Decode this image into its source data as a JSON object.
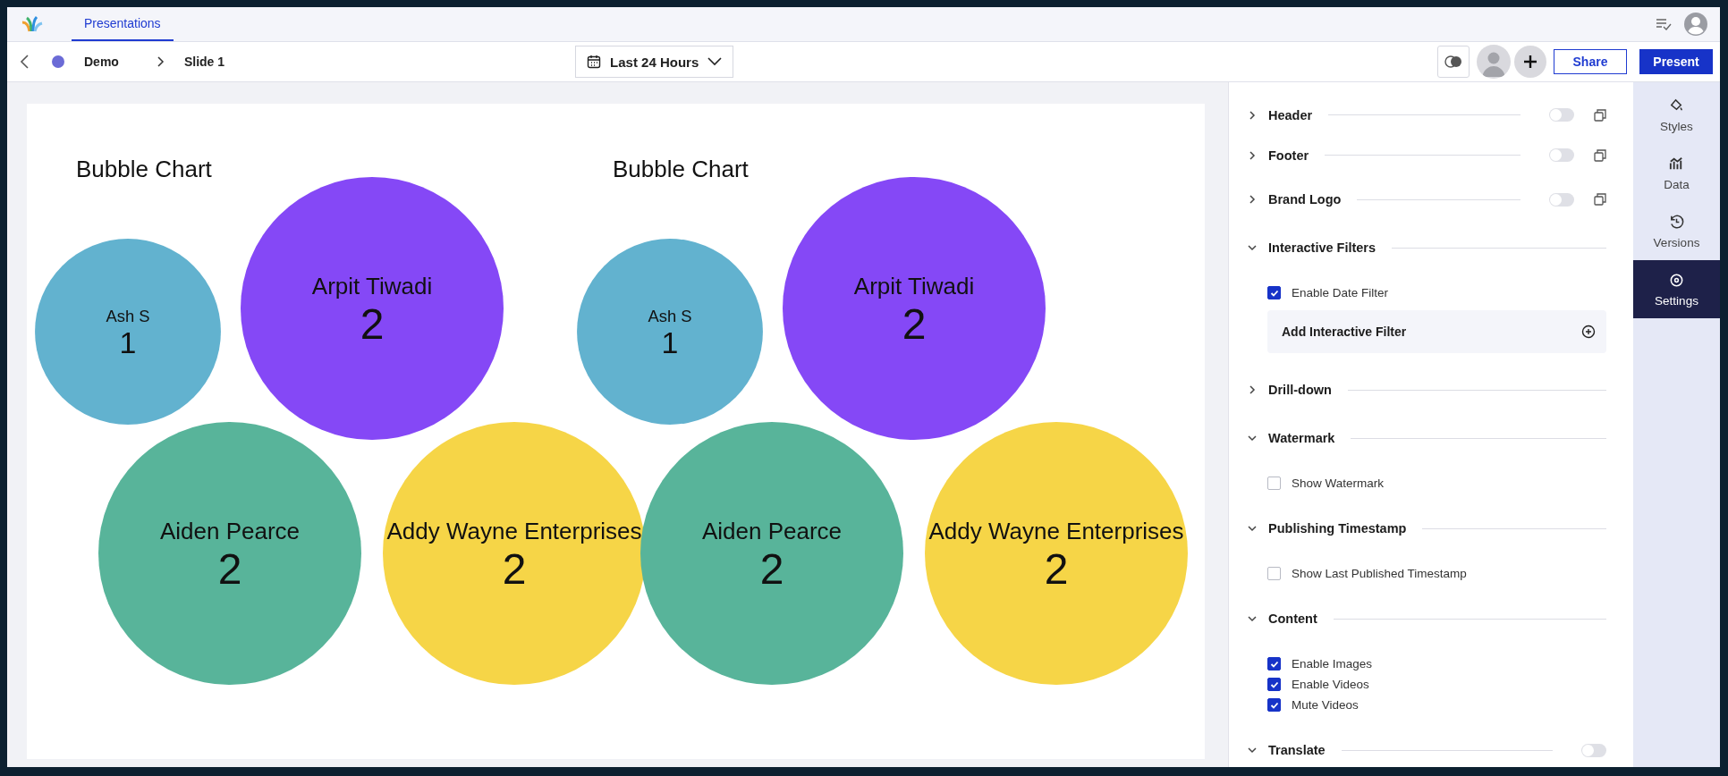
{
  "top_bar": {
    "tabs": [
      {
        "label": "Presentations",
        "selected": true
      }
    ]
  },
  "toolbar": {
    "project": "Demo",
    "page": "Slide 1",
    "date_range": "Last 24 Hours",
    "share": "Share",
    "present": "Present"
  },
  "slide": {
    "charts": [
      {
        "title": "Bubble Chart",
        "bubbles": [
          {
            "name": "Ash S",
            "value": "1",
            "color": "#62b2cf"
          },
          {
            "name": "Arpit Tiwadi",
            "value": "2",
            "color": "#8548f6"
          },
          {
            "name": "Aiden Pearce",
            "value": "2",
            "color": "#58b49a"
          },
          {
            "name": "Addy Wayne Enterprises",
            "value": "2",
            "color": "#f6d547"
          }
        ]
      },
      {
        "title": "Bubble Chart",
        "bubbles": [
          {
            "name": "Ash S",
            "value": "1",
            "color": "#62b2cf"
          },
          {
            "name": "Arpit Tiwadi",
            "value": "2",
            "color": "#8548f6"
          },
          {
            "name": "Aiden Pearce",
            "value": "2",
            "color": "#58b49a"
          },
          {
            "name": "Addy Wayne Enterprises",
            "value": "2",
            "color": "#f6d547"
          }
        ]
      }
    ]
  },
  "settings": {
    "sections": [
      {
        "kind": "block",
        "title": "Header",
        "expanded": false,
        "on": false
      },
      {
        "kind": "block",
        "title": "Footer",
        "expanded": false,
        "on": false
      },
      {
        "kind": "block",
        "title": "Brand Logo",
        "expanded": false,
        "on": false
      },
      {
        "kind": "group",
        "title": "Interactive Filters",
        "expanded": true,
        "items": [
          {
            "kind": "checkbox",
            "label": "Enable Date Filter",
            "checked": true
          },
          {
            "kind": "action",
            "label": "Add Interactive Filter"
          }
        ]
      },
      {
        "kind": "group",
        "title": "Drill-down",
        "expanded": false
      },
      {
        "kind": "group",
        "title": "Watermark",
        "expanded": true,
        "items": [
          {
            "kind": "checkbox",
            "label": "Show Watermark",
            "checked": false
          }
        ]
      },
      {
        "kind": "group",
        "title": "Publishing Timestamp",
        "expanded": true,
        "items": [
          {
            "kind": "checkbox",
            "label": "Show Last Published Timestamp",
            "checked": false
          }
        ]
      },
      {
        "kind": "group",
        "title": "Content",
        "expanded": true,
        "items": [
          {
            "kind": "checkbox",
            "label": "Enable Images",
            "checked": true
          },
          {
            "kind": "checkbox",
            "label": "Enable Videos",
            "checked": true
          },
          {
            "kind": "checkbox",
            "label": "Mute Videos",
            "checked": true
          }
        ]
      },
      {
        "kind": "switch",
        "title": "Translate",
        "expanded": true,
        "on": false
      }
    ]
  },
  "side_tabs": [
    {
      "label": "Styles",
      "selected": false
    },
    {
      "label": "Data",
      "selected": false
    },
    {
      "label": "Versions",
      "selected": false
    },
    {
      "label": "Settings",
      "selected": true
    }
  ]
}
